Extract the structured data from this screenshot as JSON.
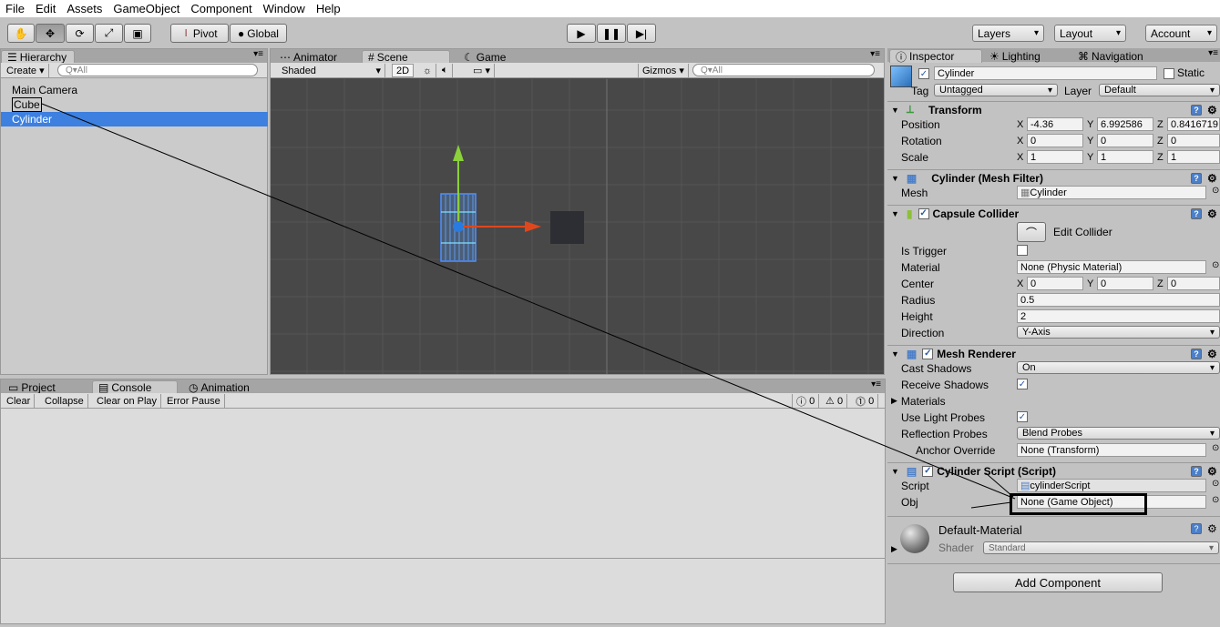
{
  "menu": [
    "File",
    "Edit",
    "Assets",
    "GameObject",
    "Component",
    "Window",
    "Help"
  ],
  "toolbar": {
    "pivot": "Pivot",
    "global": "Global",
    "layers": "Layers",
    "layout": "Layout",
    "account": "Account"
  },
  "hierarchy": {
    "tab": "Hierarchy",
    "create": "Create",
    "search": "Q▾All",
    "items": [
      "Main Camera",
      "Cube",
      "Cylinder"
    ]
  },
  "scene": {
    "tabs": [
      "Animator",
      "Scene",
      "Game"
    ],
    "shading": "Shaded",
    "mode2d": "2D",
    "gizmos": "Gizmos",
    "search": "Q▾All"
  },
  "console": {
    "tabs": [
      "Project",
      "Console",
      "Animation"
    ],
    "buttons": [
      "Clear",
      "Collapse",
      "Clear on Play",
      "Error Pause"
    ],
    "counts": [
      "0",
      "0",
      "0"
    ]
  },
  "inspector": {
    "tabs": [
      "Inspector",
      "Lighting",
      "Navigation"
    ],
    "name": "Cylinder",
    "static": "Static",
    "tag_label": "Tag",
    "tag": "Untagged",
    "layer_label": "Layer",
    "layer": "Default",
    "transform": {
      "title": "Transform",
      "position_label": "Position",
      "rotation_label": "Rotation",
      "scale_label": "Scale",
      "position": [
        "-4.36",
        "6.992586",
        "0.8416719"
      ],
      "rotation": [
        "0",
        "0",
        "0"
      ],
      "scale": [
        "1",
        "1",
        "1"
      ]
    },
    "axes": [
      "X",
      "Y",
      "Z"
    ],
    "mesh_filter": {
      "title": "Cylinder (Mesh Filter)",
      "mesh_label": "Mesh",
      "mesh": "Cylinder"
    },
    "capsule": {
      "title": "Capsule Collider",
      "edit": "Edit Collider",
      "trigger": "Is Trigger",
      "material_label": "Material",
      "material": "None (Physic Material)",
      "center_label": "Center",
      "center": [
        "0",
        "0",
        "0"
      ],
      "radius_label": "Radius",
      "radius": "0.5",
      "height_label": "Height",
      "height": "2",
      "direction_label": "Direction",
      "direction": "Y-Axis"
    },
    "renderer": {
      "title": "Mesh Renderer",
      "cast_label": "Cast Shadows",
      "cast": "On",
      "receive_label": "Receive Shadows",
      "materials": "Materials",
      "probes_label": "Use Light Probes",
      "refl_label": "Reflection Probes",
      "refl": "Blend Probes",
      "anchor_label": "Anchor Override",
      "anchor": "None (Transform)"
    },
    "script": {
      "title": "Cylinder Script (Script)",
      "script_label": "Script",
      "script": "cylinderScript",
      "obj_label": "Obj",
      "obj": "None (Game Object)"
    },
    "material": {
      "name": "Default-Material",
      "shader_label": "Shader",
      "shader": "Standard"
    },
    "add_component": "Add Component"
  }
}
